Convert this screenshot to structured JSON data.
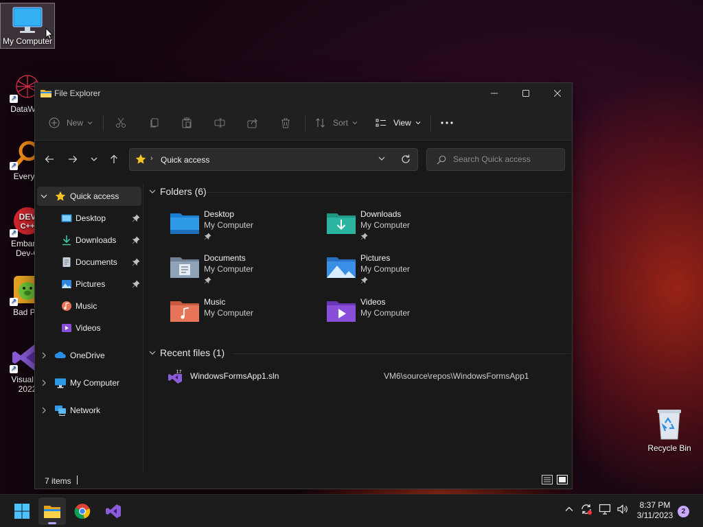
{
  "desktop": {
    "icons": [
      {
        "label": "My Computer",
        "icon": "monitor-icon"
      },
      {
        "label": "DataWag",
        "icon": "datawagon-icon"
      },
      {
        "label": "Everyth",
        "icon": "everything-search-icon"
      },
      {
        "label": "Embarca",
        "label2": "Dev-C",
        "icon": "devcpp-icon"
      },
      {
        "label": "Bad Pig",
        "icon": "bad-piggies-icon"
      },
      {
        "label": "Visual St",
        "label2": "2022",
        "icon": "visual-studio-icon"
      }
    ],
    "recycle_bin": "Recycle Bin"
  },
  "window": {
    "title": "File Explorer",
    "toolbar": {
      "new_label": "New",
      "sort_label": "Sort",
      "view_label": "View"
    },
    "address": {
      "path": "Quick access"
    },
    "search": {
      "placeholder": "Search Quick access"
    },
    "sidebar": {
      "quick_access": "Quick access",
      "items": [
        {
          "label": "Desktop",
          "icon": "desktop-folder-icon",
          "pinned": true
        },
        {
          "label": "Downloads",
          "icon": "downloads-icon",
          "pinned": true
        },
        {
          "label": "Documents",
          "icon": "documents-icon",
          "pinned": true
        },
        {
          "label": "Pictures",
          "icon": "pictures-icon",
          "pinned": true
        },
        {
          "label": "Music",
          "icon": "music-icon",
          "pinned": false
        },
        {
          "label": "Videos",
          "icon": "videos-icon",
          "pinned": false
        }
      ],
      "onedrive": "OneDrive",
      "my_computer": "My Computer",
      "network": "Network"
    },
    "content": {
      "folders_heading": "Folders (6)",
      "folders": [
        {
          "name": "Desktop",
          "location": "My Computer",
          "pinned": true,
          "color": "#2f9be8"
        },
        {
          "name": "Downloads",
          "location": "My Computer",
          "pinned": true,
          "color": "#2bb5a0"
        },
        {
          "name": "Documents",
          "location": "My Computer",
          "pinned": true,
          "color": "#8ea3b8"
        },
        {
          "name": "Pictures",
          "location": "My Computer",
          "pinned": true,
          "color": "#3a8ee6"
        },
        {
          "name": "Music",
          "location": "My Computer",
          "pinned": false,
          "color": "#e8745a"
        },
        {
          "name": "Videos",
          "location": "My Computer",
          "pinned": false,
          "color": "#8a4fd8"
        }
      ],
      "recent_heading": "Recent files (1)",
      "recent": [
        {
          "name": "WindowsFormsApp1.sln",
          "path": "VM6\\source\\repos\\WindowsFormsApp1"
        }
      ]
    },
    "status": {
      "item_count": "7 items"
    }
  },
  "taskbar": {
    "time": "8:37 PM",
    "date": "3/11/2023",
    "notification_count": "2"
  }
}
